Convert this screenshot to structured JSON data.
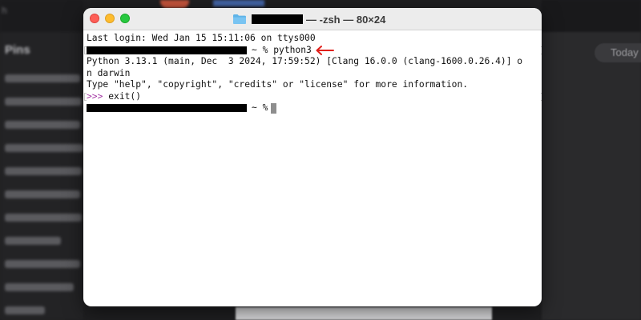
{
  "background": {
    "sidebar_corner": "h",
    "sidebar_heading": "Pins",
    "today_button": "Today"
  },
  "window": {
    "title": "— -zsh — 80×24",
    "colors": {
      "close": "#fe5f57",
      "minimize": "#febc2e",
      "maximize": "#28c840",
      "repl_prompt": "#a43aa5",
      "arrow": "#e0201b"
    }
  },
  "terminal": {
    "last_login": "Last login: Wed Jan 15 15:11:06 on ttys000",
    "prompt_suffix": "~ %",
    "command": "python3",
    "python_banner_1": "Python 3.13.1 (main, Dec  3 2024, 17:59:52) [Clang 16.0.0 (clang-1600.0.26.4)] o",
    "python_banner_2": "n darwin",
    "python_banner_3": "Type \"help\", \"copyright\", \"credits\" or \"license\" for more information.",
    "repl_prompt": ">>>",
    "repl_command": "exit()",
    "final_prompt_suffix": "~ %"
  }
}
